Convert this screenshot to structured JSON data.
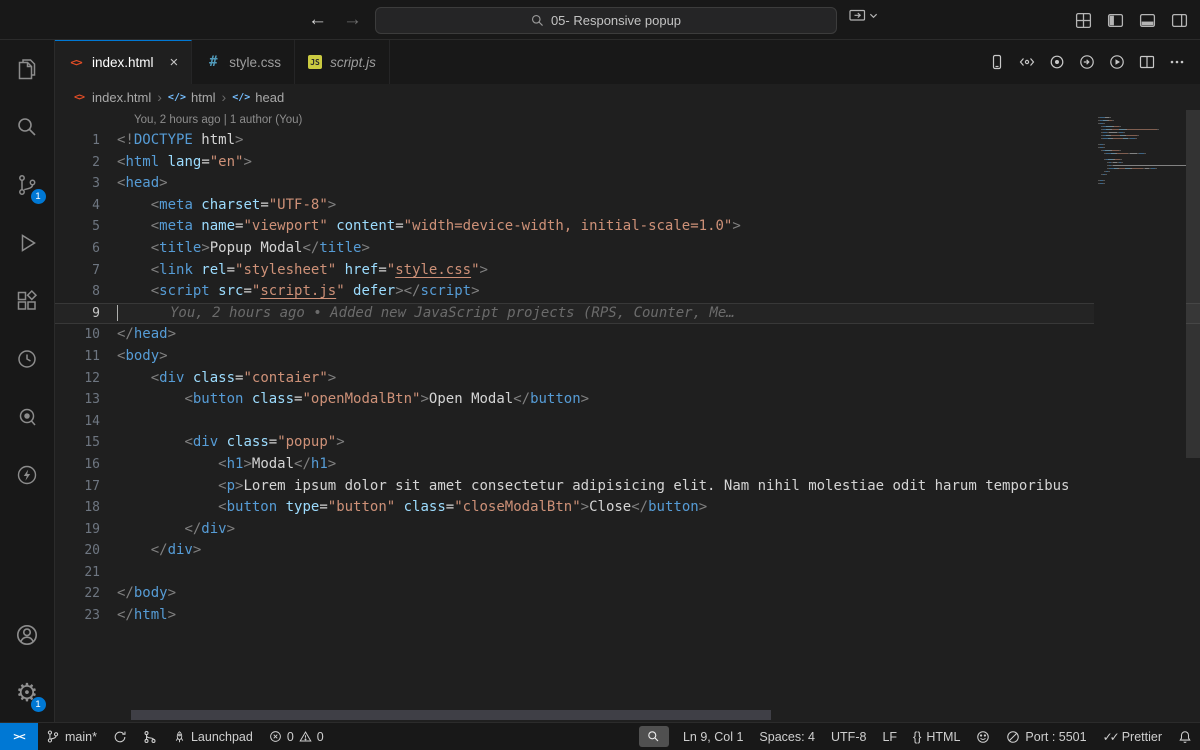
{
  "titlebar": {
    "back_icon": "←",
    "forward_icon": "→",
    "search_text": "05- Responsive popup"
  },
  "tabs": {
    "tab1": {
      "label": "index.html",
      "close": "×"
    },
    "tab2": {
      "label": "style.css"
    },
    "tab3": {
      "label": "script.js"
    }
  },
  "breadcrumb": {
    "file": "index.html",
    "sep": "›",
    "item2": "html",
    "item3": "head",
    "sym": "</>"
  },
  "activitybar": {
    "scm_badge": "1",
    "settings_badge": "1"
  },
  "editor": {
    "lens": "You, 2 hours ago | 1 author (You)",
    "lines": [
      {
        "n": 1,
        "t": [
          [
            "punct",
            "<!"
          ],
          [
            "tag",
            "DOCTYPE"
          ],
          [
            "plain",
            " html"
          ],
          [
            "punct",
            ">"
          ]
        ]
      },
      {
        "n": 2,
        "t": [
          [
            "punct",
            "<"
          ],
          [
            "tag",
            "html"
          ],
          [
            "attr",
            " lang"
          ],
          [
            "plain",
            "="
          ],
          [
            "str",
            "\"en\""
          ],
          [
            "punct",
            ">"
          ]
        ]
      },
      {
        "n": 3,
        "t": [
          [
            "punct",
            "<"
          ],
          [
            "tag",
            "head"
          ],
          [
            "punct",
            ">"
          ]
        ]
      },
      {
        "n": 4,
        "t": [
          [
            "plain",
            "    "
          ],
          [
            "punct",
            "<"
          ],
          [
            "tag",
            "meta"
          ],
          [
            "attr",
            " charset"
          ],
          [
            "plain",
            "="
          ],
          [
            "str",
            "\"UTF-8\""
          ],
          [
            "punct",
            ">"
          ]
        ]
      },
      {
        "n": 5,
        "t": [
          [
            "plain",
            "    "
          ],
          [
            "punct",
            "<"
          ],
          [
            "tag",
            "meta"
          ],
          [
            "attr",
            " name"
          ],
          [
            "plain",
            "="
          ],
          [
            "str",
            "\"viewport\""
          ],
          [
            "attr",
            " content"
          ],
          [
            "plain",
            "="
          ],
          [
            "str",
            "\"width=device-width, initial-scale=1.0\""
          ],
          [
            "punct",
            ">"
          ]
        ]
      },
      {
        "n": 6,
        "t": [
          [
            "plain",
            "    "
          ],
          [
            "punct",
            "<"
          ],
          [
            "tag",
            "title"
          ],
          [
            "punct",
            ">"
          ],
          [
            "plain",
            "Popup Modal"
          ],
          [
            "punct",
            "</"
          ],
          [
            "tag",
            "title"
          ],
          [
            "punct",
            ">"
          ]
        ]
      },
      {
        "n": 7,
        "t": [
          [
            "plain",
            "    "
          ],
          [
            "punct",
            "<"
          ],
          [
            "tag",
            "link"
          ],
          [
            "attr",
            " rel"
          ],
          [
            "plain",
            "="
          ],
          [
            "str",
            "\"stylesheet\""
          ],
          [
            "attr",
            " href"
          ],
          [
            "plain",
            "="
          ],
          [
            "str",
            "\""
          ],
          [
            "link",
            "style.css"
          ],
          [
            "str",
            "\""
          ],
          [
            "punct",
            ">"
          ]
        ]
      },
      {
        "n": 8,
        "t": [
          [
            "plain",
            "    "
          ],
          [
            "punct",
            "<"
          ],
          [
            "tag",
            "script"
          ],
          [
            "attr",
            " src"
          ],
          [
            "plain",
            "="
          ],
          [
            "str",
            "\""
          ],
          [
            "link",
            "script.js"
          ],
          [
            "str",
            "\""
          ],
          [
            "attr",
            " defer"
          ],
          [
            "punct",
            "></"
          ],
          [
            "tag",
            "script"
          ],
          [
            "punct",
            ">"
          ]
        ]
      },
      {
        "n": 9,
        "t": [],
        "cur": true,
        "blame": "You, 2 hours ago • Added new JavaScript projects (RPS, Counter, Me…"
      },
      {
        "n": 10,
        "t": [
          [
            "punct",
            "</"
          ],
          [
            "tag",
            "head"
          ],
          [
            "punct",
            ">"
          ]
        ]
      },
      {
        "n": 11,
        "t": [
          [
            "punct",
            "<"
          ],
          [
            "tag",
            "body"
          ],
          [
            "punct",
            ">"
          ]
        ]
      },
      {
        "n": 12,
        "t": [
          [
            "plain",
            "    "
          ],
          [
            "punct",
            "<"
          ],
          [
            "tag",
            "div"
          ],
          [
            "attr",
            " class"
          ],
          [
            "plain",
            "="
          ],
          [
            "str",
            "\"contaier\""
          ],
          [
            "punct",
            ">"
          ]
        ]
      },
      {
        "n": 13,
        "t": [
          [
            "plain",
            "        "
          ],
          [
            "punct",
            "<"
          ],
          [
            "tag",
            "button"
          ],
          [
            "attr",
            " class"
          ],
          [
            "plain",
            "="
          ],
          [
            "str",
            "\"openModalBtn\""
          ],
          [
            "punct",
            ">"
          ],
          [
            "plain",
            "Open Modal"
          ],
          [
            "punct",
            "</"
          ],
          [
            "tag",
            "button"
          ],
          [
            "punct",
            ">"
          ]
        ]
      },
      {
        "n": 14,
        "t": []
      },
      {
        "n": 15,
        "t": [
          [
            "plain",
            "        "
          ],
          [
            "punct",
            "<"
          ],
          [
            "tag",
            "div"
          ],
          [
            "attr",
            " class"
          ],
          [
            "plain",
            "="
          ],
          [
            "str",
            "\"popup\""
          ],
          [
            "punct",
            ">"
          ]
        ]
      },
      {
        "n": 16,
        "t": [
          [
            "plain",
            "            "
          ],
          [
            "punct",
            "<"
          ],
          [
            "tag",
            "h1"
          ],
          [
            "punct",
            ">"
          ],
          [
            "plain",
            "Modal"
          ],
          [
            "punct",
            "</"
          ],
          [
            "tag",
            "h1"
          ],
          [
            "punct",
            ">"
          ]
        ]
      },
      {
        "n": 17,
        "t": [
          [
            "plain",
            "            "
          ],
          [
            "punct",
            "<"
          ],
          [
            "tag",
            "p"
          ],
          [
            "punct",
            ">"
          ],
          [
            "plain",
            "Lorem ipsum dolor sit amet consectetur adipisicing elit. Nam nihil molestiae odit harum temporibus"
          ]
        ]
      },
      {
        "n": 18,
        "t": [
          [
            "plain",
            "            "
          ],
          [
            "punct",
            "<"
          ],
          [
            "tag",
            "button"
          ],
          [
            "attr",
            " type"
          ],
          [
            "plain",
            "="
          ],
          [
            "str",
            "\"button\""
          ],
          [
            "attr",
            " class"
          ],
          [
            "plain",
            "="
          ],
          [
            "str",
            "\"closeModalBtn\""
          ],
          [
            "punct",
            ">"
          ],
          [
            "plain",
            "Close"
          ],
          [
            "punct",
            "</"
          ],
          [
            "tag",
            "button"
          ],
          [
            "punct",
            ">"
          ]
        ]
      },
      {
        "n": 19,
        "t": [
          [
            "plain",
            "        "
          ],
          [
            "punct",
            "</"
          ],
          [
            "tag",
            "div"
          ],
          [
            "punct",
            ">"
          ]
        ]
      },
      {
        "n": 20,
        "t": [
          [
            "plain",
            "    "
          ],
          [
            "punct",
            "</"
          ],
          [
            "tag",
            "div"
          ],
          [
            "punct",
            ">"
          ]
        ]
      },
      {
        "n": 21,
        "t": []
      },
      {
        "n": 22,
        "t": [
          [
            "punct",
            "</"
          ],
          [
            "tag",
            "body"
          ],
          [
            "punct",
            ">"
          ]
        ]
      },
      {
        "n": 23,
        "t": [
          [
            "punct",
            "</"
          ],
          [
            "tag",
            "html"
          ],
          [
            "punct",
            ">"
          ]
        ]
      }
    ]
  },
  "statusbar": {
    "remote_icon": "><",
    "branch": "main*",
    "launchpad": "Launchpad",
    "errors": "0",
    "warnings": "0",
    "line_col": "Ln 9, Col 1",
    "indent": "Spaces: 4",
    "encoding": "UTF-8",
    "eol": "LF",
    "braces": "{}",
    "language": "HTML",
    "port": "Port : 5501",
    "check_icon": "✓",
    "formatter": "Prettier"
  },
  "colors": {
    "accent": "#0078d4",
    "tag": "#569cd6",
    "attr": "#9cdcfe",
    "string": "#ce9178",
    "editor_bg": "#1f1f1f"
  }
}
